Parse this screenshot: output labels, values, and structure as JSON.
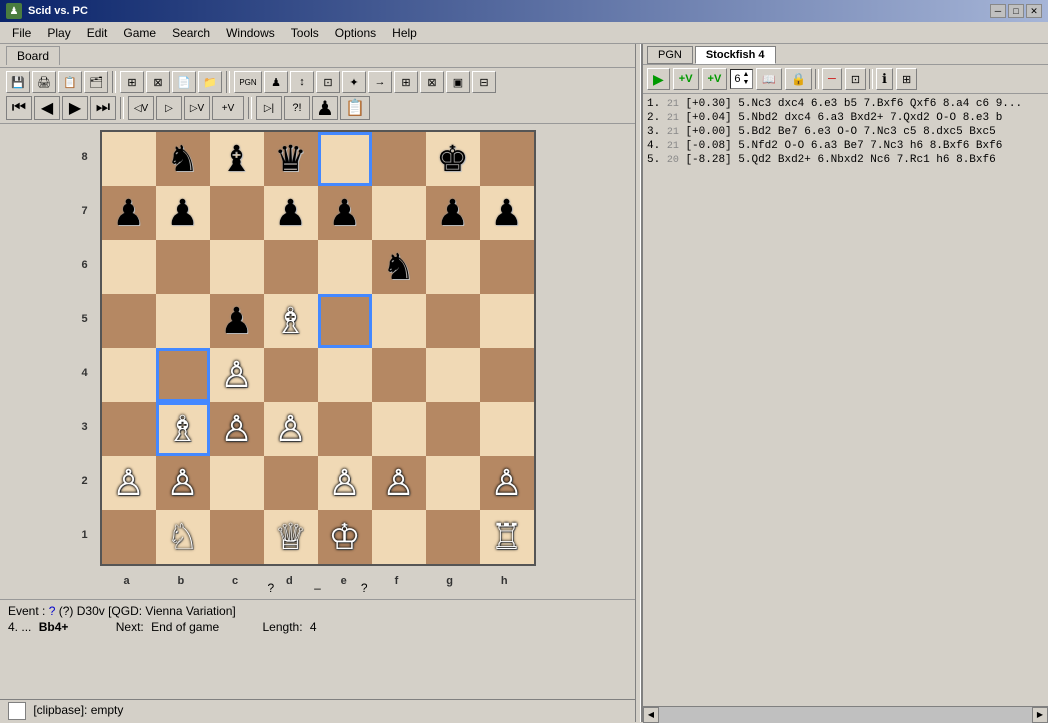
{
  "titleBar": {
    "title": "Scid vs. PC",
    "minBtn": "─",
    "maxBtn": "□",
    "closeBtn": "✕"
  },
  "menuBar": {
    "items": [
      "File",
      "Play",
      "Edit",
      "Game",
      "Search",
      "Windows",
      "Tools",
      "Options",
      "Help"
    ]
  },
  "leftPanel": {
    "boardTab": "Board",
    "toolbar1": {
      "btns": [
        "💾",
        "🖨",
        "📋",
        "🗂",
        "⊞",
        "⊠",
        "📄",
        "📁"
      ]
    }
  },
  "navControls": {
    "first": "⏮",
    "prev": "◀",
    "next": "▶",
    "last": "⏭",
    "prevVar": "◁V",
    "nextVar1": "▷",
    "nextVar2": "▷V",
    "addVar": "+V",
    "markStart": "▷|",
    "annot": "?!",
    "pieces": "♟",
    "clipboard": "📋"
  },
  "enginePanel": {
    "tabs": [
      {
        "label": "PGN",
        "active": false
      },
      {
        "label": "Stockfish 4",
        "active": true
      }
    ],
    "toolbar": {
      "play": "▶",
      "plusV": "+V",
      "plusCap": "+V",
      "depth_label": "6",
      "book": "📖",
      "lock": "🔒",
      "minus": "─",
      "multi": "⊡",
      "info": "ℹ",
      "extra": "⊞"
    },
    "lines": [
      {
        "num": "1.",
        "depth": "21",
        "score": "[+0.30]",
        "moves": "5.Nc3 dxc4 6.e3 b5 7.Bxf6 Qxf6 8.a4 c6 9..."
      },
      {
        "num": "2.",
        "depth": "21",
        "score": "[+0.04]",
        "moves": "5.Nbd2 dxc4 6.a3 Bxd2+ 7.Qxd2 O-O 8.e3 b"
      },
      {
        "num": "3.",
        "depth": "21",
        "score": "[+0.00]",
        "moves": "5.Bd2 Be7 6.e3 O-O 7.Nc3 c5 8.dxc5 Bxc5"
      },
      {
        "num": "4.",
        "depth": "21",
        "score": "[-0.08]",
        "moves": "5.Nfd2 O-O 6.a3 Be7 7.Nc3 h6 8.Bxf6 Bxf6"
      },
      {
        "num": "5.",
        "depth": "20",
        "score": "[-8.28]",
        "moves": "5.Qd2 Bxd2+ 6.Nbxd2 Nc6 7.Rc1 h6 8.Bxf6"
      }
    ]
  },
  "statusArea": {
    "event_label": "Event :",
    "event_value": "?",
    "brackets": "(?)  D30v [QGD: Vienna Variation]",
    "move_num": "4.",
    "move_dots": "...",
    "move": "Bb4+",
    "next_label": "Next:",
    "next_value": "End of game",
    "length_label": "Length:",
    "length_value": "4"
  },
  "clipbase": "[clipbase]:  empty"
}
